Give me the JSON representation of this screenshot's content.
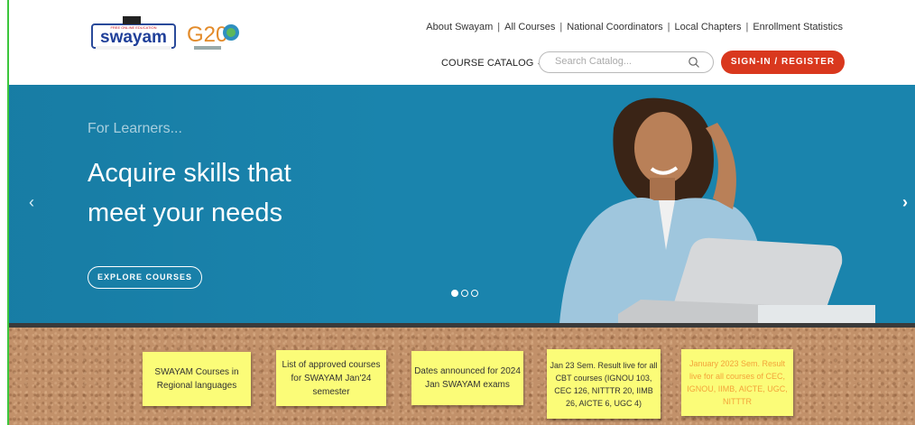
{
  "header": {
    "logo_text": "swayam",
    "logo_tagline": "FREE ONLINE EDUCATION",
    "g20_text": "G20",
    "links": [
      "About Swayam",
      "All Courses",
      "National Coordinators",
      "Local Chapters",
      "Enrollment Statistics"
    ],
    "catalog_label": "COURSE CATALOG",
    "search_placeholder": "Search Catalog...",
    "signin_label": "SIGN-IN / REGISTER"
  },
  "hero": {
    "eyebrow": "For Learners...",
    "headline_line1": "Acquire skills that",
    "headline_line2": "meet your needs",
    "cta_label": "EXPLORE COURSES",
    "prev_arrow": "‹",
    "next_arrow": "›",
    "slides_total": 3,
    "active_slide": 1
  },
  "notices": [
    {
      "text": "SWAYAM Courses in Regional languages"
    },
    {
      "text": "List of approved courses for SWAYAM Jan'24 semester"
    },
    {
      "text": "Dates announced for 2024 Jan SWAYAM exams"
    },
    {
      "text": "Jan 23 Sem. Result live for all CBT courses (IGNOU 103, CEC 126, NITTTR 20, IIMB 26, AICTE 6, UGC 4)"
    },
    {
      "text": "January 2023 Sem. Result live for all courses of CEC, IGNOU, IIMB, AICTE, UGC, NITTTR"
    }
  ],
  "colors": {
    "hero_bg": "#1a84ad",
    "signin_bg": "#d9381e",
    "note_bg": "#fbfc78",
    "cork": "#c2916a"
  }
}
